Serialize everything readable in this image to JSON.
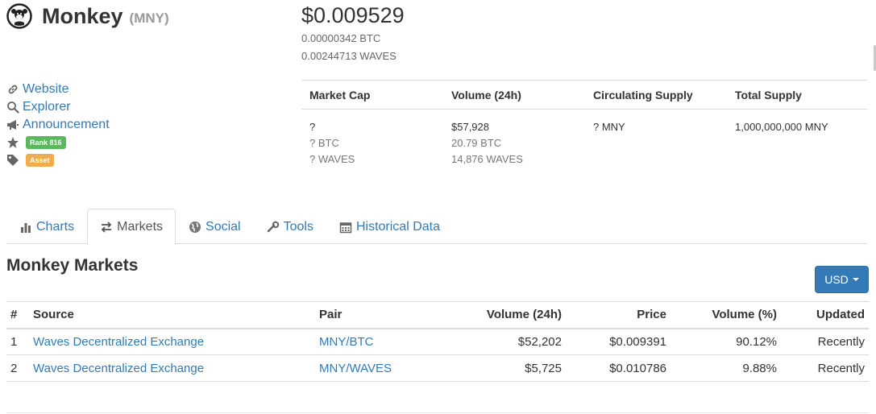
{
  "coin": {
    "name": "Monkey",
    "symbol": "(MNY)",
    "price_usd": "$0.009529",
    "price_btc": "0.00000342 BTC",
    "price_waves": "0.00244713 WAVES"
  },
  "links": {
    "website": "Website",
    "explorer": "Explorer",
    "announcement": "Announcement",
    "rank": "Rank 816",
    "tag": "Asset"
  },
  "stats": {
    "headers": [
      "Market Cap",
      "Volume (24h)",
      "Circulating Supply",
      "Total Supply"
    ],
    "market_cap": [
      "?",
      "? BTC",
      "? WAVES"
    ],
    "volume": [
      "$57,928",
      "20.79 BTC",
      "14,876 WAVES"
    ],
    "circulating": "? MNY",
    "total": "1,000,000,000 MNY"
  },
  "tabs": [
    {
      "label": "Charts"
    },
    {
      "label": "Markets"
    },
    {
      "label": "Social"
    },
    {
      "label": "Tools"
    },
    {
      "label": "Historical Data"
    }
  ],
  "markets": {
    "title": "Monkey Markets",
    "currency_button": "USD",
    "columns": [
      "#",
      "Source",
      "Pair",
      "Volume (24h)",
      "Price",
      "Volume (%)",
      "Updated"
    ],
    "rows": [
      {
        "n": "1",
        "source": "Waves Decentralized Exchange",
        "pair": "MNY/BTC",
        "volume": "$52,202",
        "price": "$0.009391",
        "pct": "90.12%",
        "updated": "Recently"
      },
      {
        "n": "2",
        "source": "Waves Decentralized Exchange",
        "pair": "MNY/WAVES",
        "volume": "$5,725",
        "price": "$0.010786",
        "pct": "9.88%",
        "updated": "Recently"
      }
    ]
  },
  "colors": {
    "link": "#337ab7",
    "rank_badge": "#5cb85c",
    "asset_badge": "#f0ad4e",
    "button": "#337ab7"
  }
}
